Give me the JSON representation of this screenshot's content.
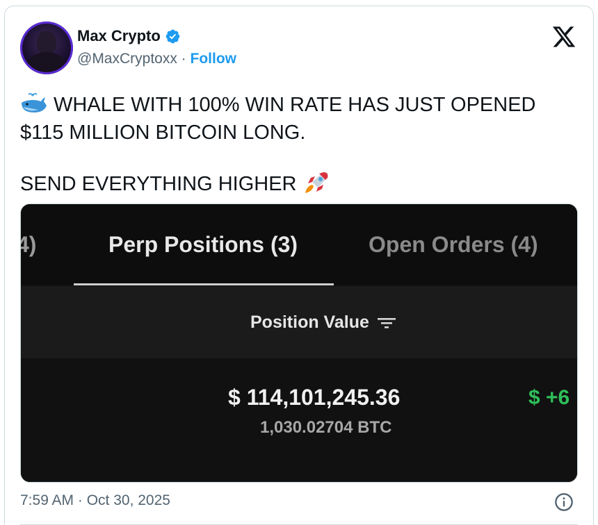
{
  "author": {
    "display_name": "Max Crypto",
    "handle": "@MaxCryptoxx",
    "separator": " · ",
    "follow_label": "Follow",
    "verified_color": "#1d9bf0"
  },
  "tweet": {
    "line1": " WHALE WITH 100% WIN RATE HAS JUST OPENED",
    "line2": "$115 MILLION BITCOIN LONG.",
    "line3": "SEND EVERYTHING HIGHER ",
    "emojis": [
      "whale-emoji",
      "rocket-emoji"
    ]
  },
  "media": {
    "tab_cut_text": "4)",
    "tab_active": "Perp Positions (3)",
    "tab_inactive": "Open Orders (4)",
    "column_title": "Position Value",
    "position_value": "$ 114,101,245.36",
    "position_size": "1,030.02704 BTC",
    "pnl_partial": "$ +6",
    "pnl_color": "#2fbf5a"
  },
  "footer": {
    "timestamp": "7:59 AM · Oct 30, 2025"
  }
}
